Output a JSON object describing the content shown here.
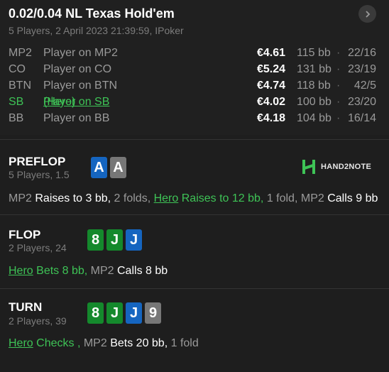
{
  "header": {
    "title": "0.02/0.04 NL Texas Hold'em",
    "subtitle": "5 Players, 2 April 2023 21:39:59, IPoker"
  },
  "players": [
    {
      "pos": "MP2",
      "name": "Player on MP2",
      "hero_suffix": "",
      "stack": "€4.61",
      "bb": "115 bb",
      "hands": "22/16"
    },
    {
      "pos": "CO",
      "name": "Player on CO",
      "hero_suffix": "",
      "stack": "€5.24",
      "bb": "131 bb",
      "hands": "23/19"
    },
    {
      "pos": "BTN",
      "name": "Player on BTN",
      "hero_suffix": "",
      "stack": "€4.74",
      "bb": "118 bb",
      "hands": "42/5"
    },
    {
      "pos": "SB",
      "name": "Player on SB",
      "hero_suffix": "(Hero)",
      "stack": "€4.02",
      "bb": "100 bb",
      "hands": "23/20"
    },
    {
      "pos": "BB",
      "name": "Player on BB",
      "hero_suffix": "",
      "stack": "€4.18",
      "bb": "104 bb",
      "hands": "16/14"
    }
  ],
  "dot": "·",
  "logo_text": "HAND2NOTE",
  "streets": {
    "preflop": {
      "name": "PREFLOP",
      "info": "5 Players, 1.5",
      "cards": [
        {
          "rank": "A",
          "color": "#1565c0"
        },
        {
          "rank": "A",
          "color": "#777777"
        }
      ],
      "actions": {
        "p1": "MP2",
        "a1": "Raises to 3 bb,",
        "f1": "2 folds,",
        "hero": "Hero",
        "ha": "Raises to 12 bb,",
        "f2": "1 fold,",
        "p2": "MP2",
        "a2": "Calls 9 bb"
      }
    },
    "flop": {
      "name": "FLOP",
      "info": "2 Players, 24",
      "cards": [
        {
          "rank": "8",
          "color": "#14892c"
        },
        {
          "rank": "J",
          "color": "#14892c"
        },
        {
          "rank": "J",
          "color": "#1565c0"
        }
      ],
      "actions": {
        "hero": "Hero",
        "ha": "Bets 8 bb,",
        "p1": "MP2",
        "a1": "Calls 8 bb"
      }
    },
    "turn": {
      "name": "TURN",
      "info": "2 Players, 39",
      "cards": [
        {
          "rank": "8",
          "color": "#14892c"
        },
        {
          "rank": "J",
          "color": "#14892c"
        },
        {
          "rank": "J",
          "color": "#1565c0"
        },
        {
          "rank": "9",
          "color": "#777777"
        }
      ],
      "actions": {
        "hero": "Hero",
        "ha": "Checks ,",
        "p1": "MP2",
        "a1": "Bets 20 bb,",
        "f1": "1 fold"
      }
    }
  }
}
